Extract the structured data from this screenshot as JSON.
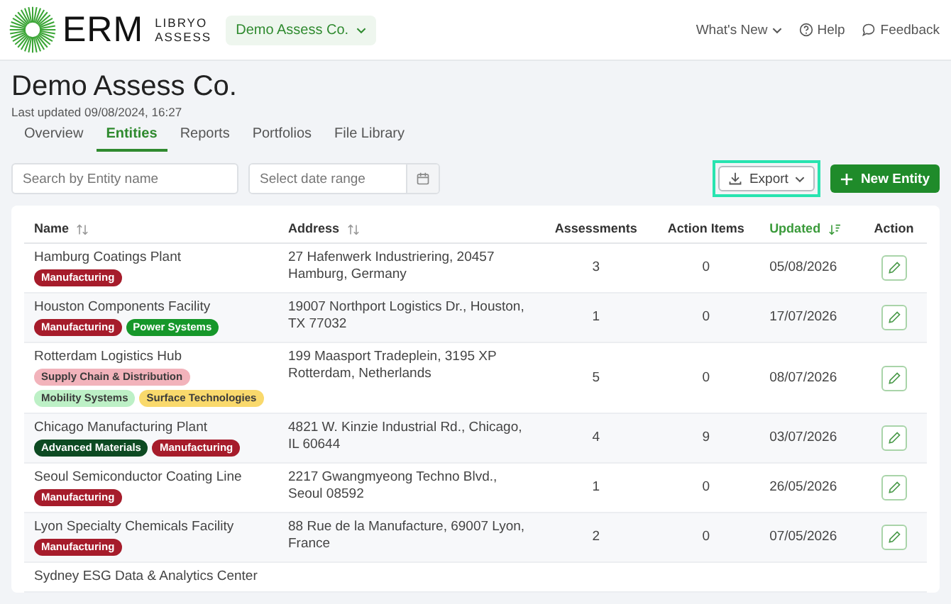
{
  "header": {
    "logo_text": "ERM",
    "logo_sub": [
      "LIBRYO",
      "ASSESS"
    ],
    "org_switcher": "Demo Assess Co.",
    "nav": [
      {
        "label": "What's New",
        "kind": "dropdown"
      },
      {
        "label": "Help",
        "kind": "help"
      },
      {
        "label": "Feedback",
        "kind": "feedback"
      }
    ]
  },
  "page": {
    "title": "Demo Assess Co.",
    "last_updated": "Last updated 09/08/2024, 16:27"
  },
  "tabs": [
    {
      "label": "Overview",
      "selected": false
    },
    {
      "label": "Entities",
      "selected": true
    },
    {
      "label": "Reports",
      "selected": false
    },
    {
      "label": "Portfolios",
      "selected": false
    },
    {
      "label": "File Library",
      "selected": false
    }
  ],
  "toolbar": {
    "search": {
      "placeholder": "Search by Entity name"
    },
    "date_range": {
      "placeholder": "Select date range"
    },
    "export": {
      "label": "Export",
      "focused": true
    },
    "new_entity": {
      "label": "New Entity"
    }
  },
  "table": {
    "columns": [
      {
        "label": "Name",
        "sortable": true,
        "sorted": false
      },
      {
        "label": "Address",
        "sortable": true,
        "sorted": false
      },
      {
        "label": "Assessments",
        "sortable": false,
        "sorted": false
      },
      {
        "label": "Action Items",
        "sortable": false,
        "sorted": false
      },
      {
        "label": "Updated",
        "sortable": true,
        "sorted": true
      },
      {
        "label": "Action",
        "sortable": false,
        "sorted": false
      }
    ],
    "rows": [
      {
        "name": "Hamburg Coatings Plant",
        "tags": [
          {
            "label": "Manufacturing",
            "color": "#a61c2b"
          }
        ],
        "address": "27 Hafenwerk Industriering, 20457 Hamburg, Germany",
        "assessments": "3",
        "action_items": "0",
        "updated": "05/08/2026"
      },
      {
        "name": "Houston Components Facility",
        "tags": [
          {
            "label": "Manufacturing",
            "color": "#a61c2b"
          },
          {
            "label": "Power Systems",
            "color": "#16972a"
          }
        ],
        "address": "19007 Northport Logistics Dr., Houston, TX 77032",
        "assessments": "1",
        "action_items": "0",
        "updated": "17/07/2026"
      },
      {
        "name": "Rotterdam Logistics Hub",
        "tags": [
          {
            "label": "Supply Chain & Distribution",
            "color": "#f2b3bb"
          },
          {
            "label": "Mobility Systems",
            "color": "#bdf0c6"
          },
          {
            "label": "Surface Technologies",
            "color": "#f9d96c"
          }
        ],
        "address": "199 Maasport Tradeplein, 3195 XP Rotterdam, Netherlands",
        "assessments": "5",
        "action_items": "0",
        "updated": "08/07/2026"
      },
      {
        "name": "Chicago Manufacturing Plant",
        "tags": [
          {
            "label": "Advanced Materials",
            "color": "#0d4a22"
          },
          {
            "label": "Manufacturing",
            "color": "#a61c2b"
          }
        ],
        "address": "4821 W. Kinzie Industrial Rd., Chicago, IL 60644",
        "assessments": "4",
        "action_items": "9",
        "updated": "03/07/2026"
      },
      {
        "name": "Seoul Semiconductor Coating Line",
        "tags": [
          {
            "label": "Manufacturing",
            "color": "#a61c2b"
          }
        ],
        "address": "2217 Gwangmyeong Techno Blvd., Seoul 08592",
        "assessments": "1",
        "action_items": "0",
        "updated": "26/05/2026"
      },
      {
        "name": "Lyon Specialty Chemicals Facility",
        "tags": [
          {
            "label": "Manufacturing",
            "color": "#a61c2b"
          }
        ],
        "address": "88 Rue de la Manufacture, 69007 Lyon, France",
        "assessments": "2",
        "action_items": "0",
        "updated": "07/05/2026"
      },
      {
        "name": "Sydney ESG Data & Analytics Center",
        "tags": []
      }
    ]
  }
}
